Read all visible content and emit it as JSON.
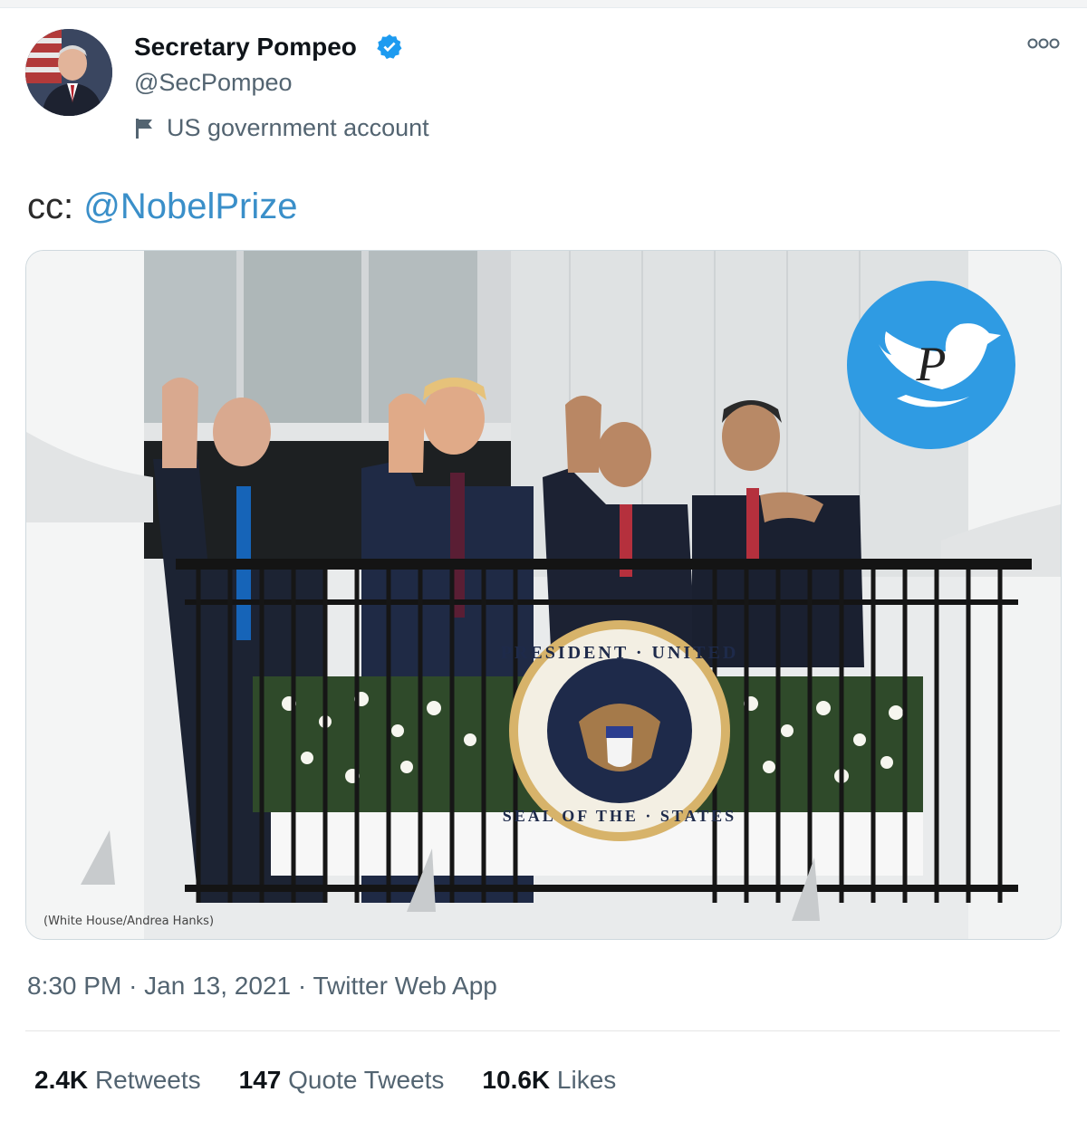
{
  "tweet": {
    "author": {
      "name": "Secretary Pompeo",
      "handle": "@SecPompeo",
      "label": "US government account",
      "verified_color": "#1d9bf0"
    },
    "text": {
      "prefix": "cc:",
      "mention": "@NobelPrize"
    },
    "media": {
      "credit": "(White House/Andrea Hanks)",
      "seal_text_top": "PRESIDENT OF THE UNITED STATES",
      "seal_text_bottom": "SEAL OF THE"
    },
    "meta": {
      "time": "8:30 PM",
      "date": "Jan 13, 2021",
      "source": "Twitter Web App"
    },
    "stats": {
      "retweets_count": "2.4K",
      "retweets_label": "Retweets",
      "quotes_count": "147",
      "quotes_label": "Quote Tweets",
      "likes_count": "10.6K",
      "likes_label": "Likes"
    }
  },
  "colors": {
    "link": "#3a8fc9",
    "muted": "#536471",
    "watermark_blue": "#2f9be3"
  }
}
